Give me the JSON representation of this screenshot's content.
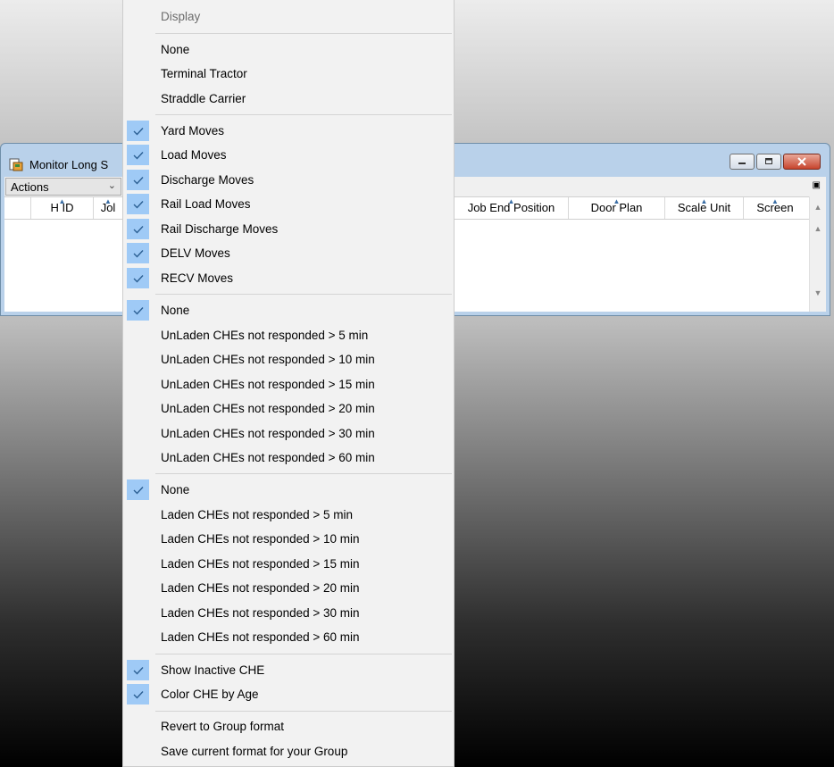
{
  "window": {
    "title": "Monitor Long S",
    "actions_label": "Actions",
    "columns": [
      {
        "label": "H ID"
      },
      {
        "label": "Jol"
      },
      {
        "label": "Job End Position"
      },
      {
        "label": "Door Plan"
      },
      {
        "label": "Scale Unit"
      },
      {
        "label": "Screen"
      }
    ]
  },
  "menu": {
    "header": "Display",
    "display_items": [
      {
        "label": "None",
        "checked": false
      },
      {
        "label": "Terminal Tractor",
        "checked": false
      },
      {
        "label": "Straddle Carrier",
        "checked": false
      }
    ],
    "move_items": [
      {
        "label": "Yard Moves",
        "checked": true
      },
      {
        "label": "Load Moves",
        "checked": true
      },
      {
        "label": "Discharge Moves",
        "checked": true
      },
      {
        "label": "Rail Load Moves",
        "checked": true
      },
      {
        "label": "Rail Discharge Moves",
        "checked": true
      },
      {
        "label": "DELV Moves",
        "checked": true
      },
      {
        "label": "RECV Moves",
        "checked": true
      }
    ],
    "unladen_items": [
      {
        "label": "None",
        "checked": true
      },
      {
        "label": "UnLaden CHEs not responded > 5 min",
        "checked": false
      },
      {
        "label": "UnLaden CHEs not responded > 10 min",
        "checked": false
      },
      {
        "label": "UnLaden CHEs not responded > 15 min",
        "checked": false
      },
      {
        "label": "UnLaden CHEs not responded > 20 min",
        "checked": false
      },
      {
        "label": "UnLaden CHEs not responded > 30 min",
        "checked": false
      },
      {
        "label": "UnLaden CHEs not responded > 60 min",
        "checked": false
      }
    ],
    "laden_items": [
      {
        "label": "None",
        "checked": true
      },
      {
        "label": "Laden CHEs not responded > 5 min",
        "checked": false
      },
      {
        "label": "Laden CHEs not responded > 10 min",
        "checked": false
      },
      {
        "label": "Laden CHEs not responded > 15 min",
        "checked": false
      },
      {
        "label": "Laden CHEs not responded > 20 min",
        "checked": false
      },
      {
        "label": "Laden CHEs not responded > 30 min",
        "checked": false
      },
      {
        "label": "Laden CHEs not responded > 60 min",
        "checked": false
      }
    ],
    "option_items": [
      {
        "label": "Show Inactive CHE",
        "checked": true
      },
      {
        "label": "Color CHE by Age",
        "checked": true
      }
    ],
    "format_items": [
      {
        "label": "Revert to Group format",
        "checked": false
      },
      {
        "label": "Save current format for your Group",
        "checked": false
      }
    ],
    "check_color": "#9fcaf6"
  }
}
